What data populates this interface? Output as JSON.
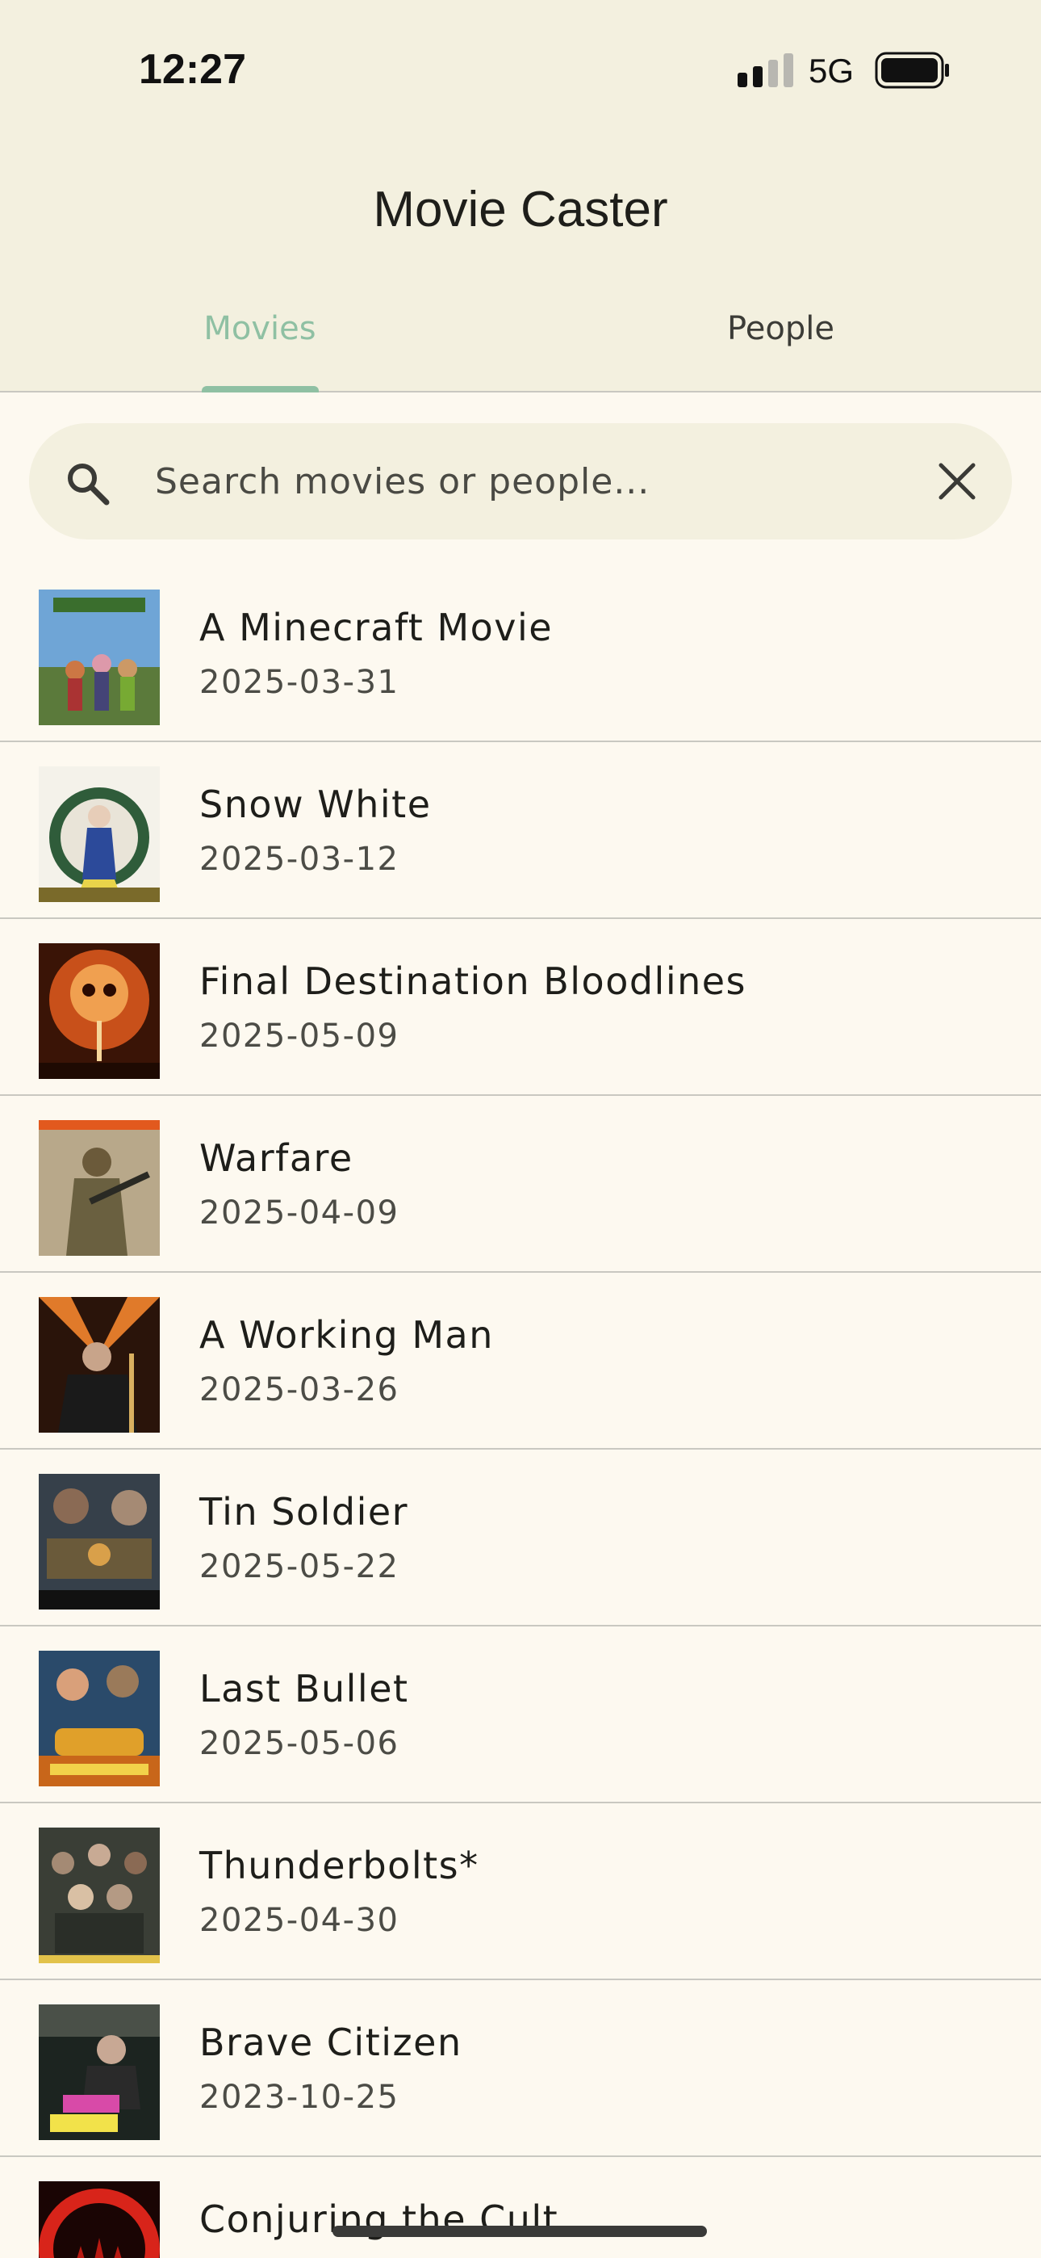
{
  "status_bar": {
    "time": "12:27",
    "network": "5G"
  },
  "app": {
    "title": "Movie Caster"
  },
  "tabs": [
    {
      "label": "Movies",
      "active": true
    },
    {
      "label": "People",
      "active": false
    }
  ],
  "search": {
    "placeholder": "Search movies or people...",
    "value": ""
  },
  "colors": {
    "accent": "#8fc0a3",
    "header_bg": "#f3f0df",
    "page_bg": "#fdf9f0"
  },
  "movies": [
    {
      "title": "A Minecraft Movie",
      "date": "2025-03-31"
    },
    {
      "title": "Snow White",
      "date": "2025-03-12"
    },
    {
      "title": "Final Destination Bloodlines",
      "date": "2025-05-09"
    },
    {
      "title": "Warfare",
      "date": "2025-04-09"
    },
    {
      "title": "A Working Man",
      "date": "2025-03-26"
    },
    {
      "title": "Tin Soldier",
      "date": "2025-05-22"
    },
    {
      "title": "Last Bullet",
      "date": "2025-05-06"
    },
    {
      "title": "Thunderbolts*",
      "date": "2025-04-30"
    },
    {
      "title": "Brave Citizen",
      "date": "2023-10-25"
    },
    {
      "title": "Conjuring the Cult",
      "date": ""
    }
  ]
}
